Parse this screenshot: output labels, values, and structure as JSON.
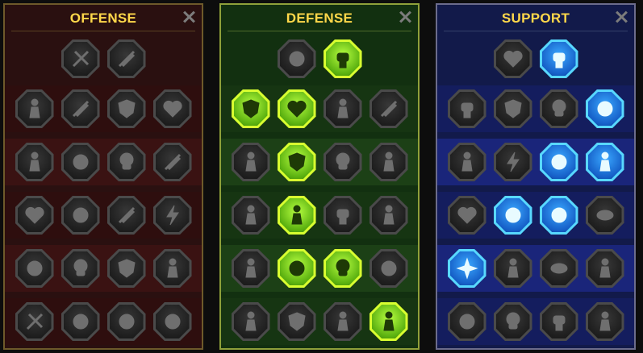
{
  "colors": {
    "title": "#ffd84a",
    "active_green": "#b8ff40",
    "active_blue": "#3aa8ff",
    "inactive": "#6f6f6f"
  },
  "panels": [
    {
      "key": "offense",
      "title": "OFFENSE",
      "close_icon": "close-icon",
      "rows": [
        [
          {
            "icon": "crossed-swords-icon",
            "active": false
          },
          {
            "icon": "triple-blades-icon",
            "active": false
          }
        ],
        [
          {
            "icon": "rage-figure-icon",
            "active": false
          },
          {
            "icon": "claw-slash-icon",
            "active": false
          },
          {
            "icon": "shield-sword-icon",
            "active": false
          },
          {
            "icon": "broken-heart-icon",
            "active": false
          }
        ],
        [
          {
            "icon": "strongman-icon",
            "active": false
          },
          {
            "icon": "fanged-mouth-icon",
            "active": false
          },
          {
            "icon": "bleeding-skull-icon",
            "active": false
          },
          {
            "icon": "scythe-icon",
            "active": false
          }
        ],
        [
          {
            "icon": "heart-sword-icon",
            "active": false
          },
          {
            "icon": "gauntlet-icon",
            "active": false
          },
          {
            "icon": "battle-axe-icon",
            "active": false
          },
          {
            "icon": "chain-lightning-icon",
            "active": false
          }
        ],
        [
          {
            "icon": "shatter-burst-icon",
            "active": false
          },
          {
            "icon": "skull-cloud-icon",
            "active": false
          },
          {
            "icon": "spear-shield-icon",
            "active": false
          },
          {
            "icon": "warrior-punch-icon",
            "active": false
          }
        ],
        [
          {
            "icon": "sword-sparkle-icon",
            "active": false
          },
          {
            "icon": "knight-helmet-icon",
            "active": false
          },
          {
            "icon": "demon-beast-icon",
            "active": false
          },
          {
            "icon": "skeleton-spider-icon",
            "active": false
          }
        ]
      ]
    },
    {
      "key": "defense",
      "title": "DEFENSE",
      "close_icon": "close-icon",
      "rows": [
        [
          {
            "icon": "brick-wall-icon",
            "active": false
          },
          {
            "icon": "raised-fist-icon",
            "active": true
          }
        ],
        [
          {
            "icon": "chevron-shield-icon",
            "active": true
          },
          {
            "icon": "flaming-heart-icon",
            "active": true
          },
          {
            "icon": "stone-golem-icon",
            "active": false
          },
          {
            "icon": "deflect-slash-icon",
            "active": false
          }
        ],
        [
          {
            "icon": "dodge-figure-icon",
            "active": false
          },
          {
            "icon": "knight-shield-icon",
            "active": true
          },
          {
            "icon": "skull-heart-icon",
            "active": false
          },
          {
            "icon": "aura-head-icon",
            "active": false
          }
        ],
        [
          {
            "icon": "crowd-icon",
            "active": false
          },
          {
            "icon": "hourglass-figure-icon",
            "active": true
          },
          {
            "icon": "stop-hand-icon",
            "active": false
          },
          {
            "icon": "bull-head-icon",
            "active": false
          }
        ],
        [
          {
            "icon": "speed-runner-icon",
            "active": false
          },
          {
            "icon": "triple-drops-icon",
            "active": true
          },
          {
            "icon": "radiant-skull-icon",
            "active": true
          },
          {
            "icon": "swirl-block-icon",
            "active": false
          }
        ],
        [
          {
            "icon": "winged-statue-icon",
            "active": false
          },
          {
            "icon": "wing-shield-icon",
            "active": false
          },
          {
            "icon": "armored-brute-icon",
            "active": false
          },
          {
            "icon": "flexing-champion-icon",
            "active": true
          }
        ]
      ]
    },
    {
      "key": "support",
      "title": "SUPPORT",
      "close_icon": "close-icon",
      "rows": [
        [
          {
            "icon": "heart-plus-icon",
            "active": false
          },
          {
            "icon": "swirling-hand-icon",
            "active": true
          }
        ],
        [
          {
            "icon": "praying-hands-icon",
            "active": false
          },
          {
            "icon": "ripple-shield-icon",
            "active": false
          },
          {
            "icon": "flaming-skull-icon",
            "active": false
          },
          {
            "icon": "speed-streak-icon",
            "active": true
          }
        ],
        [
          {
            "icon": "sparkle-figure-icon",
            "active": false
          },
          {
            "icon": "lightning-icon",
            "active": false
          },
          {
            "icon": "crackling-ground-icon",
            "active": true
          },
          {
            "icon": "twin-figures-icon",
            "active": true
          }
        ],
        [
          {
            "icon": "chained-heart-icon",
            "active": false
          },
          {
            "icon": "fire-comet-icon",
            "active": true
          },
          {
            "icon": "open-book-icon",
            "active": true
          },
          {
            "icon": "glaring-eyes-icon",
            "active": false
          }
        ],
        [
          {
            "icon": "compass-star-icon",
            "active": true
          },
          {
            "icon": "kicking-foot-icon",
            "active": false
          },
          {
            "icon": "all-seeing-eye-icon",
            "active": false
          },
          {
            "icon": "martial-kick-icon",
            "active": false
          }
        ],
        [
          {
            "icon": "poison-flask-icon",
            "active": false
          },
          {
            "icon": "grim-skull-icon",
            "active": false
          },
          {
            "icon": "dark-fist-icon",
            "active": false
          },
          {
            "icon": "eagle-head-icon",
            "active": false
          }
        ]
      ]
    }
  ]
}
